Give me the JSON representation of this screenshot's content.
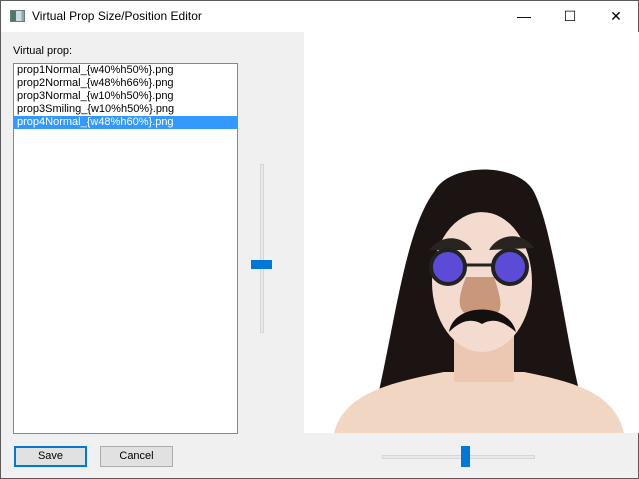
{
  "window": {
    "title": "Virtual Prop Size/Position Editor",
    "minimize": "—",
    "maximize": "☐",
    "close": "✕"
  },
  "label": "Virtual prop:",
  "props": [
    {
      "label": "prop1Normal_{w40%h50%}.png",
      "selected": false
    },
    {
      "label": "prop2Normal_{w48%h66%}.png",
      "selected": false
    },
    {
      "label": "prop3Normal_{w10%h50%}.png",
      "selected": false
    },
    {
      "label": "prop3Smiling_{w10%h50%}.png",
      "selected": false
    },
    {
      "label": "prop4Normal_{w48%h60%}.png",
      "selected": true
    }
  ],
  "vertical_slider_value": 0.41,
  "horizontal_slider_value": 0.54,
  "buttons": {
    "save": "Save",
    "cancel": "Cancel"
  },
  "colors": {
    "accent": "#0078d7",
    "selection": "#3399ff"
  }
}
